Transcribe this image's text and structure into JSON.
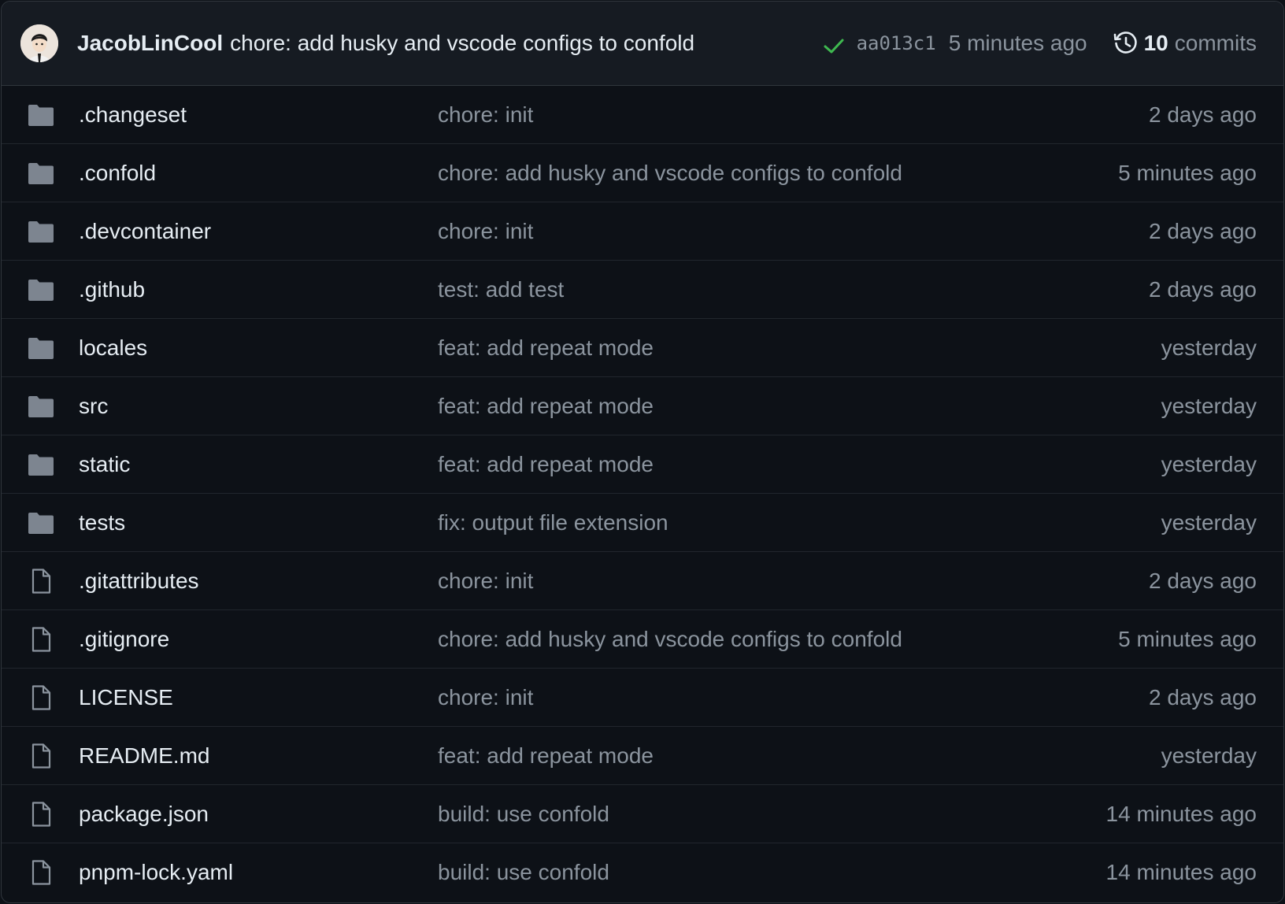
{
  "colors": {
    "background": "#0d1117",
    "header_background": "#161b22",
    "border": "#30363d",
    "text_primary": "#e6edf3",
    "text_muted": "#8b949e",
    "folder_icon": "#7d8590",
    "success": "#3fb950"
  },
  "latest_commit": {
    "avatar_icon": "avatar",
    "author": "JacobLinCool",
    "message": "chore: add husky and vscode configs to confold",
    "status_icon": "check-icon",
    "sha": "aa013c1",
    "time": "5 minutes ago",
    "history_icon": "history-icon",
    "commit_count": "10",
    "commits_label": "commits"
  },
  "files": [
    {
      "type": "folder",
      "icon": "folder-icon",
      "name": ".changeset",
      "message": "chore: init",
      "time": "2 days ago"
    },
    {
      "type": "folder",
      "icon": "folder-icon",
      "name": ".confold",
      "message": "chore: add husky and vscode configs to confold",
      "time": "5 minutes ago"
    },
    {
      "type": "folder",
      "icon": "folder-icon",
      "name": ".devcontainer",
      "message": "chore: init",
      "time": "2 days ago"
    },
    {
      "type": "folder",
      "icon": "folder-icon",
      "name": ".github",
      "message": "test: add test",
      "time": "2 days ago"
    },
    {
      "type": "folder",
      "icon": "folder-icon",
      "name": "locales",
      "message": "feat: add repeat mode",
      "time": "yesterday"
    },
    {
      "type": "folder",
      "icon": "folder-icon",
      "name": "src",
      "message": "feat: add repeat mode",
      "time": "yesterday"
    },
    {
      "type": "folder",
      "icon": "folder-icon",
      "name": "static",
      "message": "feat: add repeat mode",
      "time": "yesterday"
    },
    {
      "type": "folder",
      "icon": "folder-icon",
      "name": "tests",
      "message": "fix: output file extension",
      "time": "yesterday"
    },
    {
      "type": "file",
      "icon": "file-icon",
      "name": ".gitattributes",
      "message": "chore: init",
      "time": "2 days ago"
    },
    {
      "type": "file",
      "icon": "file-icon",
      "name": ".gitignore",
      "message": "chore: add husky and vscode configs to confold",
      "time": "5 minutes ago"
    },
    {
      "type": "file",
      "icon": "file-icon",
      "name": "LICENSE",
      "message": "chore: init",
      "time": "2 days ago"
    },
    {
      "type": "file",
      "icon": "file-icon",
      "name": "README.md",
      "message": "feat: add repeat mode",
      "time": "yesterday"
    },
    {
      "type": "file",
      "icon": "file-icon",
      "name": "package.json",
      "message": "build: use confold",
      "time": "14 minutes ago"
    },
    {
      "type": "file",
      "icon": "file-icon",
      "name": "pnpm-lock.yaml",
      "message": "build: use confold",
      "time": "14 minutes ago"
    }
  ]
}
